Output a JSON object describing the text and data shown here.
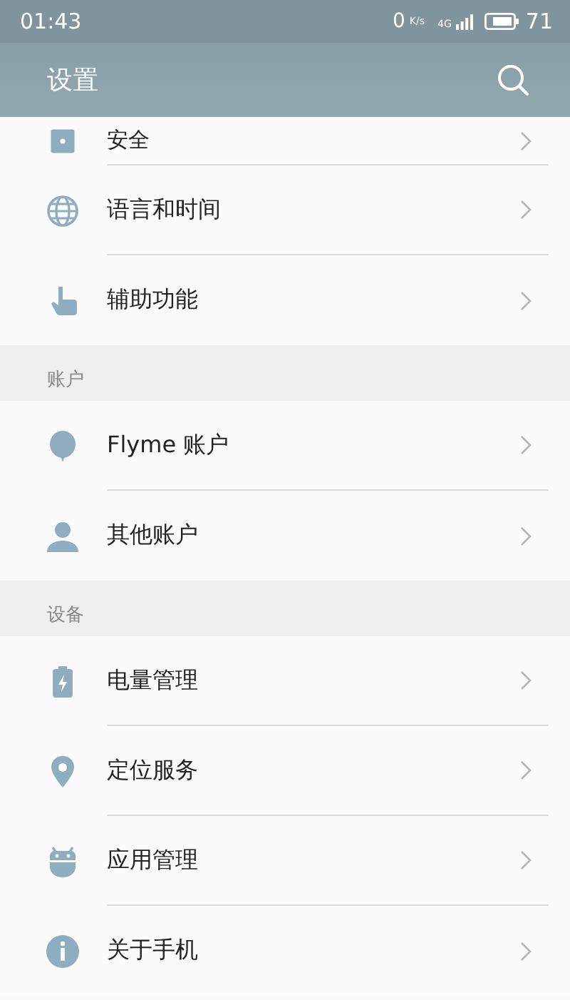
{
  "status_bar": {
    "time": "01:43",
    "net_speed": "0",
    "net_speed_unit": "K/s",
    "network": "4G",
    "battery": "71"
  },
  "header": {
    "title": "设置"
  },
  "sections": [
    {
      "items": [
        {
          "label": "安全",
          "kind": "lock"
        },
        {
          "label": "语言和时间",
          "kind": "globe"
        },
        {
          "label": "辅助功能",
          "kind": "hand"
        }
      ]
    },
    {
      "title": "账户",
      "items": [
        {
          "label": "Flyme 账户",
          "kind": "balloon"
        },
        {
          "label": "其他账户",
          "kind": "person"
        }
      ]
    },
    {
      "title": "设备",
      "items": [
        {
          "label": "电量管理",
          "kind": "battery"
        },
        {
          "label": "定位服务",
          "kind": "pin"
        },
        {
          "label": "应用管理",
          "kind": "robot"
        },
        {
          "label": "关于手机",
          "kind": "info"
        }
      ]
    }
  ]
}
